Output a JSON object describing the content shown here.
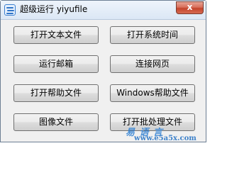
{
  "window": {
    "title": "超级运行 yiyufile",
    "close_glyph": "x",
    "icon": "app-logo-icon"
  },
  "buttons": {
    "open_text_file": "打开文本文件",
    "open_system_time": "打开系统时间",
    "run_mailbox": "运行邮箱",
    "connect_webpage": "连接网页",
    "open_help_file": "打开帮助文件",
    "windows_help_file": "Windows帮助文件",
    "image_file": "图像文件",
    "open_batch_file": "打开批处理文件"
  },
  "watermark": {
    "site": "易 语 言",
    "url": "www.e5a5x.com"
  }
}
